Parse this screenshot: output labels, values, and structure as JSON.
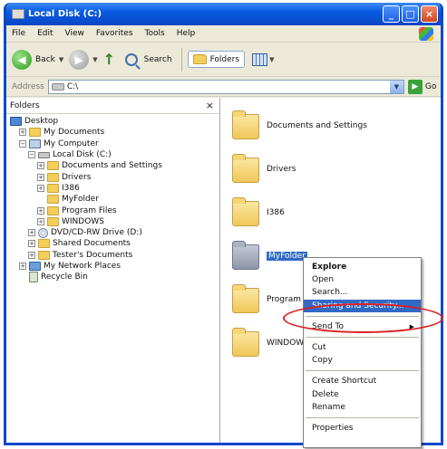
{
  "window": {
    "title": "Local Disk (C:)",
    "controls": [
      "_",
      "□",
      "×"
    ]
  },
  "menu": [
    "File",
    "Edit",
    "View",
    "Favorites",
    "Tools",
    "Help"
  ],
  "toolbar": {
    "back_label": "Back",
    "back_glyph": "◀",
    "forward_glyph": "▶",
    "up_glyph": "↑",
    "search_label": "Search",
    "folders_label": "Folders",
    "caret": "▼"
  },
  "address": {
    "label": "Address",
    "value": "C:\\",
    "go_glyph": "▶",
    "go_label": "Go"
  },
  "folders_pane": {
    "title": "Folders",
    "close_glyph": "×",
    "tree": [
      {
        "label": "Desktop",
        "depth": 0,
        "toggle": "",
        "icon": "desktop"
      },
      {
        "label": "My Documents",
        "depth": 1,
        "toggle": "+",
        "icon": "folder"
      },
      {
        "label": "My Computer",
        "depth": 1,
        "toggle": "−",
        "icon": "computer"
      },
      {
        "label": "Local Disk (C:)",
        "depth": 2,
        "toggle": "−",
        "icon": "drive"
      },
      {
        "label": "Documents and Settings",
        "depth": 3,
        "toggle": "+",
        "icon": "folder"
      },
      {
        "label": "Drivers",
        "depth": 3,
        "toggle": "+",
        "icon": "folder"
      },
      {
        "label": "I386",
        "depth": 3,
        "toggle": "+",
        "icon": "folder"
      },
      {
        "label": "MyFolder",
        "depth": 3,
        "toggle": "",
        "icon": "folder"
      },
      {
        "label": "Program Files",
        "depth": 3,
        "toggle": "+",
        "icon": "folder"
      },
      {
        "label": "WINDOWS",
        "depth": 3,
        "toggle": "+",
        "icon": "folder"
      },
      {
        "label": "DVD/CD-RW Drive (D:)",
        "depth": 2,
        "toggle": "+",
        "icon": "dvd"
      },
      {
        "label": "Shared Documents",
        "depth": 2,
        "toggle": "+",
        "icon": "folder"
      },
      {
        "label": "Tester's Documents",
        "depth": 2,
        "toggle": "+",
        "icon": "folder"
      },
      {
        "label": "My Network Places",
        "depth": 1,
        "toggle": "+",
        "icon": "network"
      },
      {
        "label": "Recycle Bin",
        "depth": 1,
        "toggle": "",
        "icon": "recycle"
      }
    ]
  },
  "files": [
    {
      "label": "Documents and Settings",
      "selected": false
    },
    {
      "label": "Drivers",
      "selected": false
    },
    {
      "label": "I386",
      "selected": false
    },
    {
      "label": "MyFolder",
      "selected": true
    },
    {
      "label": "Program Files",
      "selected": false
    },
    {
      "label": "WINDOWS",
      "selected": false
    }
  ],
  "context_menu": {
    "explore": "Explore",
    "open": "Open",
    "search": "Search...",
    "sharing": "Sharing and Security...",
    "send_to": "Send To",
    "send_to_arrow": "▶",
    "cut": "Cut",
    "copy": "Copy",
    "create_shortcut": "Create Shortcut",
    "delete": "Delete",
    "rename": "Rename",
    "properties": "Properties"
  },
  "colors": {
    "titlebar": "#0a5be0",
    "selection": "#316ac5",
    "highlight_ellipse": "#d92020"
  }
}
